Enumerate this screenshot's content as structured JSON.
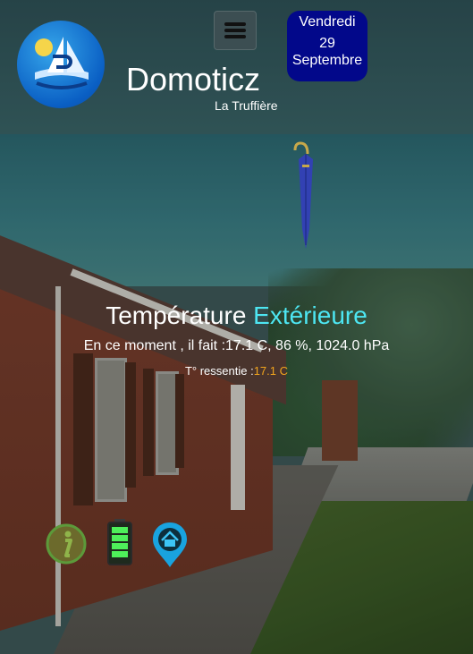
{
  "header": {
    "app_title": "Domoticz",
    "location": "La Truffière",
    "menu_icon": "hamburger-menu-icon",
    "logo_icon": "sailboat-logo-icon"
  },
  "date": {
    "weekday": "Vendredi",
    "day": "29",
    "month": "Septembre"
  },
  "weather": {
    "condition_icon": "umbrella-closed-icon",
    "title_part1": "Température",
    "title_part2": "Extérieure",
    "now_text": "En ce moment , il fait :17.1 C, 86 %, 1024.0 hPa",
    "feel_label": "T° ressentie :",
    "feel_value": "17.1 C"
  },
  "actions": {
    "info_icon": "info-icon",
    "battery_icon": "battery-full-icon",
    "home_location_icon": "home-location-pin-icon"
  },
  "colors": {
    "accent_cyan": "#4de6f2",
    "feel_orange": "#f2a51d",
    "date_badge_bg": "#02088a",
    "battery_green": "#4ef05a",
    "info_green": "#5c9a3a",
    "pin_blue": "#19a3df"
  }
}
